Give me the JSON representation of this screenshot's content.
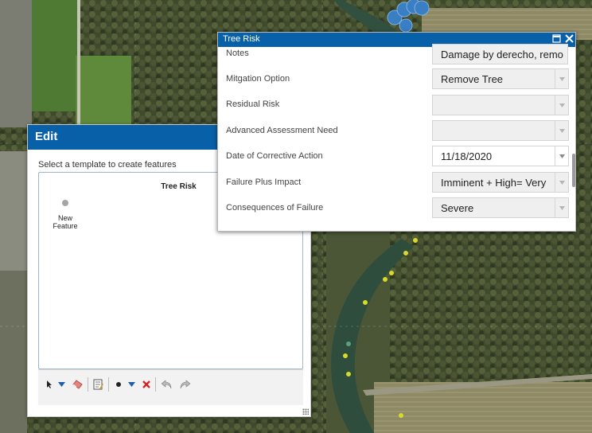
{
  "edit_widget": {
    "title": "Edit",
    "hint": "Select a template to create features",
    "template_layer": "Tree Risk",
    "template_item_label": "New Feature",
    "toolbar_icons": [
      "select-arrow-icon",
      "select-dropdown-icon",
      "eraser-icon",
      "attributes-icon",
      "point-draw-icon",
      "draw-dropdown-icon",
      "delete-icon",
      "undo-icon",
      "redo-icon"
    ]
  },
  "popup": {
    "title": "Tree Risk",
    "fields": [
      {
        "label": "Notes",
        "value": "Damage by derecho, remo",
        "has_dropdown": false,
        "editable": false
      },
      {
        "label": "Mitgation Option",
        "value": "Remove Tree",
        "has_dropdown": true,
        "editable": false
      },
      {
        "label": "Residual Risk",
        "value": "",
        "has_dropdown": true,
        "editable": false
      },
      {
        "label": "Advanced Assessment Need",
        "value": "",
        "has_dropdown": true,
        "editable": false
      },
      {
        "label": "Date of Corrective Action",
        "value": "11/18/2020",
        "has_dropdown": true,
        "editable": true
      },
      {
        "label": "Failure Plus Impact",
        "value": "Imminent +  High= Very",
        "has_dropdown": true,
        "editable": false
      },
      {
        "label": "Consequences of Failure",
        "value": "Severe",
        "has_dropdown": true,
        "editable": false
      }
    ]
  },
  "colors": {
    "header_blue": "#0860a8",
    "map_marker_blue": "#3a7fc4",
    "map_point_yellow": "#d9d92a"
  }
}
